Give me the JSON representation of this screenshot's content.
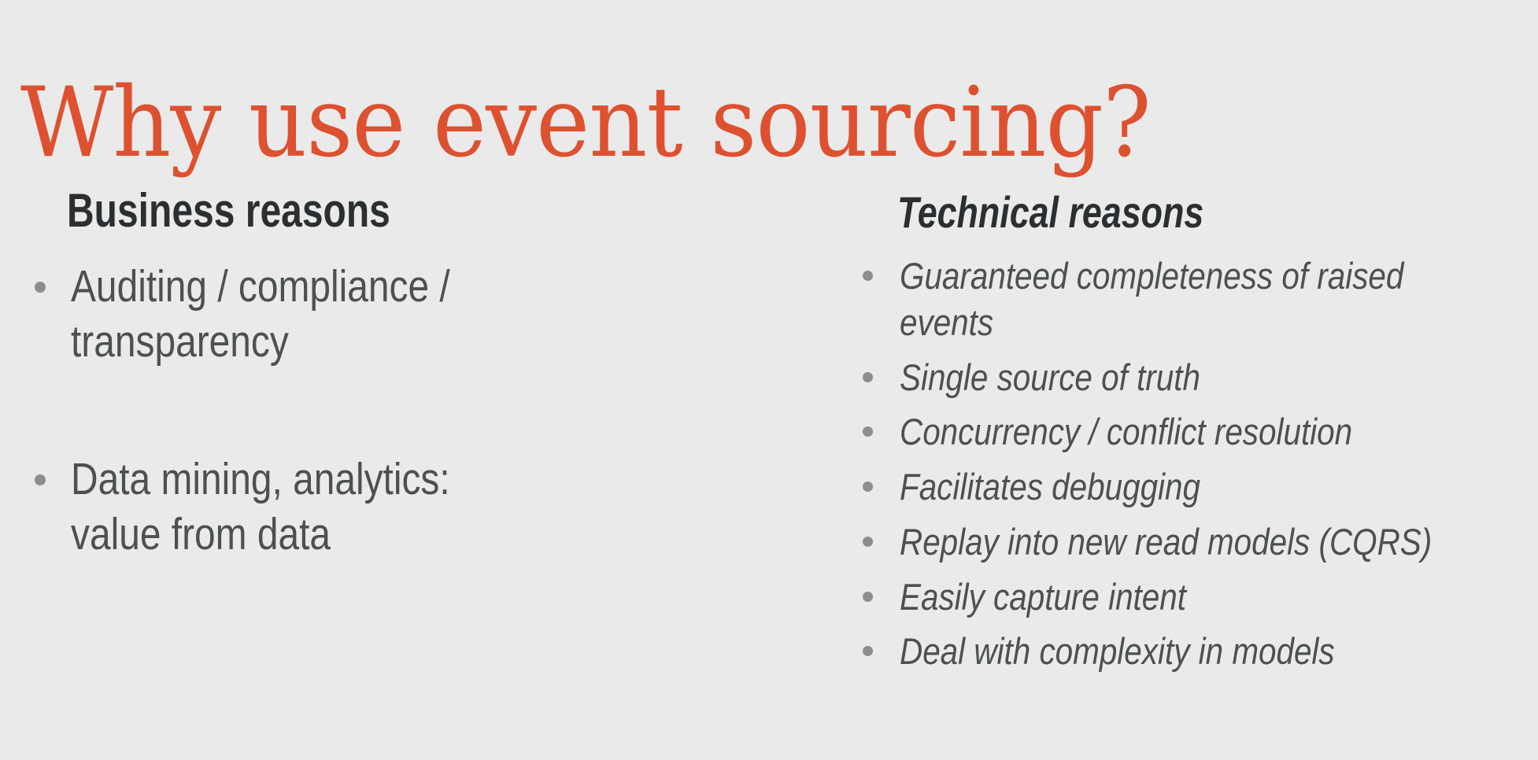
{
  "slide": {
    "background_color": "#eaeaea",
    "title": "Why use event sourcing?",
    "title_color": "#dd5130",
    "heading_color": "#2b2f31",
    "body_color": "#4c5052",
    "bullet_color": "#8d8d8d"
  },
  "columns": {
    "business": {
      "heading": "Business reasons",
      "bullets": [
        {
          "lines": [
            "Auditing / compliance /",
            "transparency"
          ]
        },
        {
          "lines": [
            "Data mining, analytics:",
            "value from data"
          ]
        }
      ]
    },
    "technical": {
      "heading": "Technical reasons",
      "bullets": [
        {
          "lines": [
            "Guaranteed completeness of raised",
            "events"
          ]
        },
        {
          "lines": [
            "Single source of truth"
          ]
        },
        {
          "lines": [
            "Concurrency / conflict resolution"
          ]
        },
        {
          "lines": [
            "Facilitates debugging"
          ]
        },
        {
          "lines": [
            "Replay into new read models (CQRS)"
          ]
        },
        {
          "lines": [
            "Easily capture intent"
          ]
        },
        {
          "lines": [
            "Deal with complexity in models"
          ]
        }
      ]
    }
  }
}
